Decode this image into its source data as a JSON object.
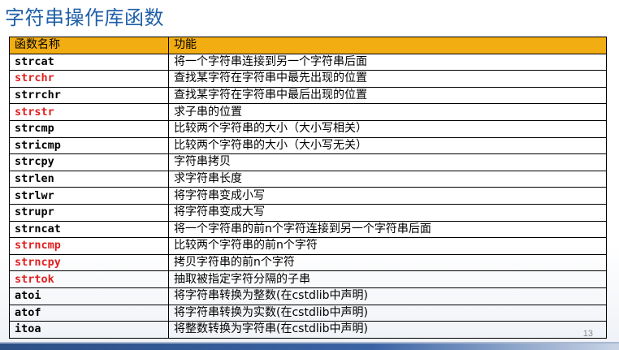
{
  "slide": {
    "title": "字符串操作库函数",
    "page_number": "13"
  },
  "table": {
    "headers": [
      "函数名称",
      "功能"
    ],
    "rows": [
      {
        "name": "strcat",
        "desc": "将一个字符串连接到另一个字符串后面",
        "highlight": false
      },
      {
        "name": "strchr",
        "desc": "查找某字符在字符串中最先出现的位置",
        "highlight": true
      },
      {
        "name": "strrchr",
        "desc": "查找某字符在字符串中最后出现的位置",
        "highlight": false
      },
      {
        "name": "strstr",
        "desc": "求子串的位置",
        "highlight": true
      },
      {
        "name": "strcmp",
        "desc": "比较两个字符串的大小（大小写相关）",
        "highlight": false
      },
      {
        "name": "stricmp",
        "desc": "比较两个字符串的大小（大小写无关）",
        "highlight": false
      },
      {
        "name": "strcpy",
        "desc": "字符串拷贝",
        "highlight": false
      },
      {
        "name": "strlen",
        "desc": "求字符串长度",
        "highlight": false
      },
      {
        "name": "strlwr",
        "desc": "将字符串变成小写",
        "highlight": false
      },
      {
        "name": "strupr",
        "desc": "将字符串变成大写",
        "highlight": false
      },
      {
        "name": "strncat",
        "desc": "将一个字符串的前n个字符连接到另一个字符串后面",
        "highlight": false
      },
      {
        "name": "strncmp",
        "desc": "比较两个字符串的前n个字符",
        "highlight": true
      },
      {
        "name": "strncpy",
        "desc": "拷贝字符串的前n个字符",
        "highlight": true
      },
      {
        "name": "strtok",
        "desc": "抽取被指定字符分隔的子串",
        "highlight": true
      },
      {
        "name": "atoi",
        "desc": "将字符串转换为整数(在cstdlib中声明)",
        "highlight": false
      },
      {
        "name": "atof",
        "desc": "将字符串转换为实数(在cstdlib中声明)",
        "highlight": false
      },
      {
        "name": "itoa",
        "desc": "将整数转换为字符串(在cstdlib中声明)",
        "highlight": false
      }
    ]
  },
  "colors": {
    "title": "#1f5fa8",
    "header_bg": "#f2ad12",
    "highlight_text": "#e02020"
  }
}
